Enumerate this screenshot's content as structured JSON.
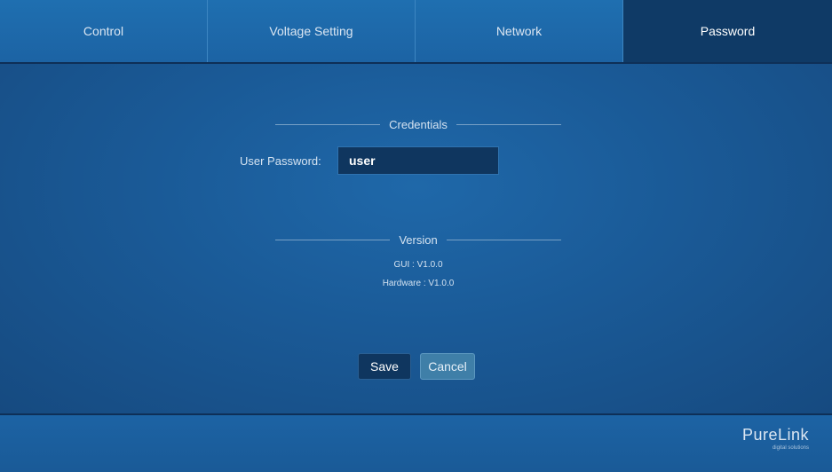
{
  "tabs": [
    {
      "label": "Control",
      "active": false
    },
    {
      "label": "Voltage Setting",
      "active": false
    },
    {
      "label": "Network",
      "active": false
    },
    {
      "label": "Password",
      "active": true
    }
  ],
  "credentials": {
    "title": "Credentials",
    "password_label": "User Password:",
    "password_value": "user"
  },
  "version": {
    "title": "Version",
    "gui": "GUI : V1.0.0",
    "hardware": "Hardware : V1.0.0"
  },
  "actions": {
    "save_label": "Save",
    "cancel_label": "Cancel"
  },
  "footer": {
    "logo_text": "PureLink",
    "logo_tagline": "digital solutions"
  },
  "colors": {
    "active_tab": "#0f3a66",
    "background": "#1a5a97"
  }
}
